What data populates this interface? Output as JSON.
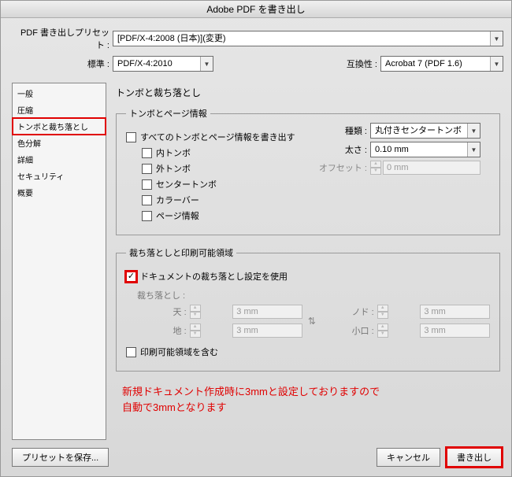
{
  "title": "Adobe PDF を書き出し",
  "preset": {
    "label": "PDF 書き出しプリセット :",
    "value": "[PDF/X-4:2008 (日本)](変更)"
  },
  "standard": {
    "label": "標準 :",
    "value": "PDF/X-4:2010"
  },
  "compat": {
    "label": "互換性 :",
    "value": "Acrobat 7 (PDF 1.6)"
  },
  "sidebar": {
    "items": [
      "一般",
      "圧縮",
      "トンボと裁ち落とし",
      "色分解",
      "詳細",
      "セキュリティ",
      "概要"
    ],
    "selected_index": 2
  },
  "content": {
    "heading": "トンボと裁ち落とし",
    "marks_group": {
      "legend": "トンボとページ情報",
      "all": "すべてのトンボとページ情報を書き出す",
      "items": [
        "内トンボ",
        "外トンボ",
        "センタートンボ",
        "カラーバー",
        "ページ情報"
      ],
      "type_label": "種類 :",
      "type_value": "丸付きセンタートンボ",
      "weight_label": "太さ :",
      "weight_value": "0.10 mm",
      "offset_label": "オフセット :",
      "offset_value": "0 mm"
    },
    "bleed_group": {
      "legend": "裁ち落としと印刷可能領域",
      "use_doc": "ドキュメントの裁ち落とし設定を使用",
      "bleed_label": "裁ち落とし :",
      "top_l": "天 :",
      "top_v": "3 mm",
      "bottom_l": "地 :",
      "bottom_v": "3 mm",
      "left_l": "ノド :",
      "left_v": "3 mm",
      "right_l": "小口 :",
      "right_v": "3 mm",
      "include_slug": "印刷可能領域を含む"
    },
    "callout_l1": "新規ドキュメント作成時に3mmと設定しておりますので",
    "callout_l2": "自動で3mmとなります"
  },
  "footer": {
    "save_preset": "プリセットを保存...",
    "cancel": "キャンセル",
    "export": "書き出し"
  }
}
